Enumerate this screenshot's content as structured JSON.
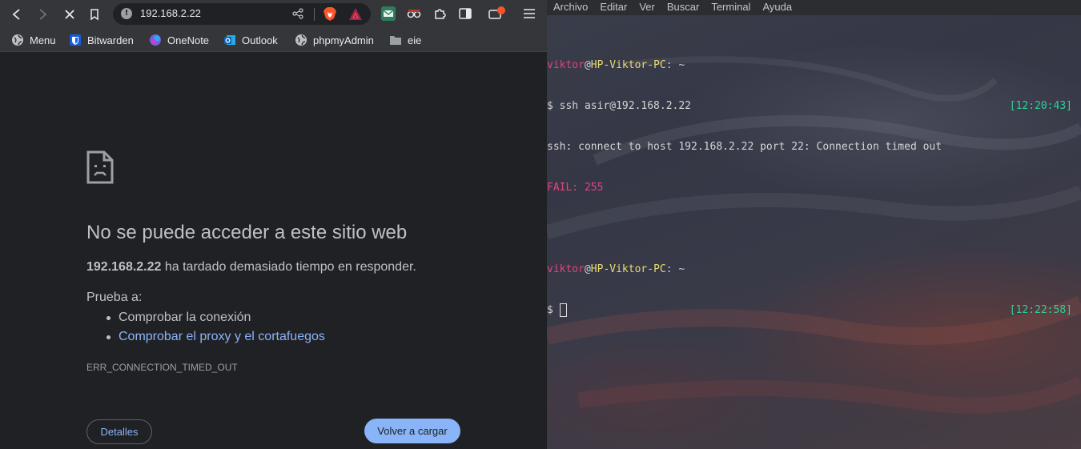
{
  "browser": {
    "url": "192.168.2.22",
    "bookmarks": [
      {
        "label": "Menu",
        "icon": "globe-icon"
      },
      {
        "label": "Bitwarden",
        "icon": "bitwarden-icon"
      },
      {
        "label": "OneNote",
        "icon": "onenote-icon"
      },
      {
        "label": "Outlook",
        "icon": "outlook-icon"
      },
      {
        "label": "phpmyAdmin",
        "icon": "globe-icon"
      },
      {
        "label": "eie",
        "icon": "folder-icon"
      }
    ],
    "error": {
      "title": "No se puede acceder a este sitio web",
      "host": "192.168.2.22",
      "description": " ha tardado demasiado tiempo en responder.",
      "try_label": "Prueba a:",
      "suggestions": [
        "Comprobar la conexión",
        "Comprobar el proxy y el cortafuegos"
      ],
      "code": "ERR_CONNECTION_TIMED_OUT",
      "details_button": "Detalles",
      "reload_button": "Volver a cargar"
    },
    "colors": {
      "link": "#8ab4f8",
      "background": "#202124"
    }
  },
  "terminal": {
    "menu": [
      "Archivo",
      "Editar",
      "Ver",
      "Buscar",
      "Terminal",
      "Ayuda"
    ],
    "lines": {
      "prompt1_user": "viktor",
      "prompt1_at": "@",
      "prompt1_host": "HP-Viktor-PC",
      "prompt1_path": ": ~",
      "cmd1": "$ ssh asir@192.168.2.22",
      "time1": "[12:20:43]",
      "output1": "ssh: connect to host 192.168.2.22 port 22: Connection timed out",
      "fail": "FAIL: 255",
      "prompt2_user": "viktor",
      "prompt2_at": "@",
      "prompt2_host": "HP-Viktor-PC",
      "prompt2_path": ": ~",
      "cmd2": "$ ",
      "time2": "[12:22:58]"
    },
    "colors": {
      "user": "#e3437f",
      "host": "#e6db74",
      "time": "#2ed19a"
    }
  }
}
